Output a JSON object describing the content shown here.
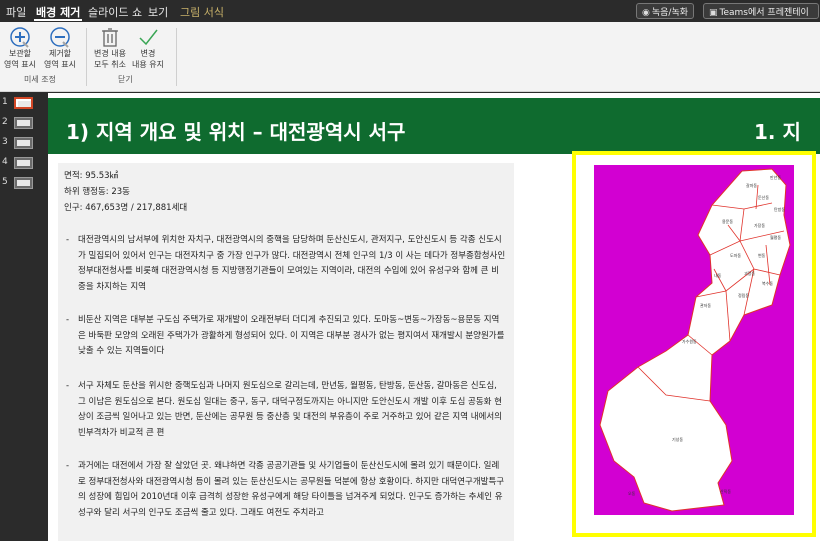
{
  "menubar": {
    "items": [
      {
        "label": "파일",
        "state": "normal"
      },
      {
        "label": "배경 제거",
        "state": "active"
      },
      {
        "label": "슬라이드 쇼",
        "state": "normal"
      },
      {
        "label": "보기",
        "state": "normal"
      },
      {
        "label": "그림 서식",
        "state": "muted"
      }
    ],
    "record_button": "녹음/녹화",
    "teams_button": "Teams에서 프레젠테이"
  },
  "ribbon": {
    "buttons": [
      {
        "line1": "보관할",
        "line2": "영역 표시"
      },
      {
        "line1": "제거할",
        "line2": "영역 표시"
      },
      {
        "line1": "변경 내용",
        "line2": "모두 취소"
      },
      {
        "line1": "변경",
        "line2": "내용 유지"
      }
    ],
    "group1_label": "미세 조정",
    "group2_label": "닫기"
  },
  "thumbnails": [
    "1",
    "2",
    "3",
    "4",
    "5"
  ],
  "slide": {
    "title": "1) 지역 개요 및 위치 – 대전광역시 서구",
    "title_right": "1. 지",
    "facts": [
      "면적: 95.53㎢",
      "하위 행정동: 23동",
      "인구: 467,653명 / 217,881세대"
    ],
    "paragraphs": [
      "대전광역시의 남서부에 위치한 자치구, 대전광역시의 중핵을 담당하며 둔산신도시, 관저지구, 도안신도시 등 각종 신도시가 밀집되어 있어서 인구는 대전자치구 중 가장 인구가 많다. 대전광역시 전체 인구의 1/3 이 사는 데다가 정부종합청사인 정부대전청사를 비롯해 대전광역시청 등 지방행정기관들이 모여있는 지역이라, 대전의 수입에 있어 유성구와 함께 큰 비중을 차지하는 지역",
      "비둔산 지역은 대부분 구도심 주택가로 재개발이 오래전부터 더디게 추진되고 있다. 도마동~변동~가장동~용문동 지역은 바둑판 모양의 오래된 주택가가 광활하게 형성되어 있다. 이 지역은 대부분 경사가 없는 평지여서 재개발시 분양원가를 낮출 수 있는 지역들이다",
      "서구 자체도 둔산을 위시한 중핵도심과 나머지 원도심으로 갈리는데, 만년동, 월평동, 탄방동, 둔산동, 갈마동은 신도심, 그 이남은 원도심으로 본다. 원도심 일대는 중구, 동구, 대덕구정도까지는 아니지만 도안신도시 개발 이후 도심 공동화 현상이 조금씩 일어나고 있는 반면, 둔산에는 공무원 등 중산층 및 대전의 부유층이 주로 거주하고 있어 같은 지역 내에서의 빈부격차가 비교적 큰 편",
      "과거에는 대전에서 가장 잘 살았던 곳. 왜냐하면 각종 공공기관들 및 사기업들이 둔산신도시에 몰려 있기 때문이다. 일례로 정부대전청사와 대전광역시청 등이 몰려 있는 둔산신도시는 공무원들 덕분에 항상 호황이다. 하지만 대덕연구개발특구의 성장에 힘입어 2010년대 이후 급격히 성장한 유성구에게 해당 타이틀을 넘겨주게 되었다. 인구도 증가하는 추세인 유성구와 달리 서구의 인구도 조금씩 줄고 있다. 그래도 여전도 주치라고"
    ],
    "map": {
      "district_labels": [
        "기성동",
        "오동",
        "갈마동",
        "둔산동",
        "용문동",
        "가장동",
        "도마동",
        "변동",
        "관저동",
        "가수원동",
        "복수동",
        "정림동",
        "월평동",
        "만년동",
        "탄방동",
        "내동",
        "괴정동",
        "산직동"
      ],
      "colors": {
        "outside": "#d200d2",
        "district_fill": "#ffffff",
        "boundary": "#e0322b"
      }
    }
  },
  "colors": {
    "title_bar": "#0f6b2f",
    "highlight_frame": "#ffff00",
    "selected_thumb": "#d24726"
  }
}
